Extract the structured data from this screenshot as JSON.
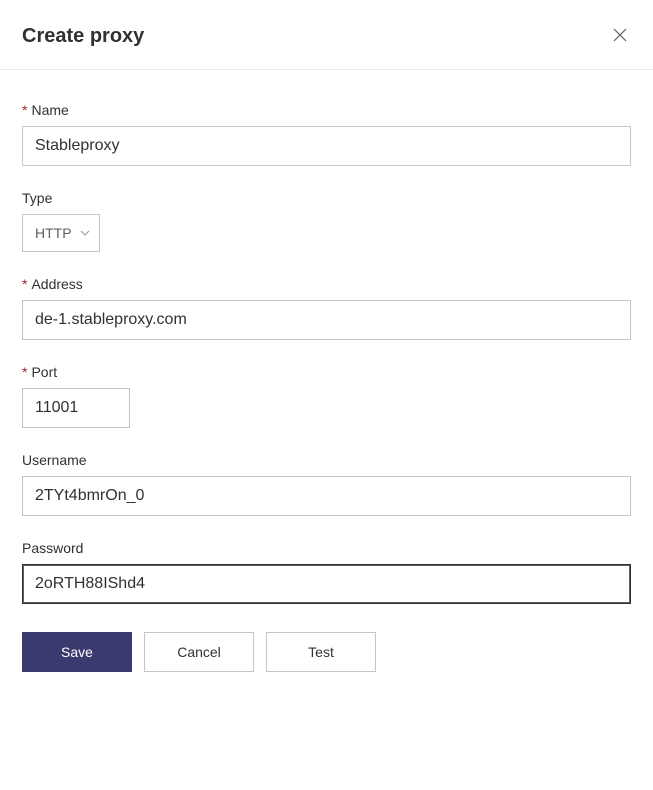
{
  "header": {
    "title": "Create proxy"
  },
  "form": {
    "name": {
      "label": "Name",
      "value": "Stableproxy",
      "required": true
    },
    "type": {
      "label": "Type",
      "value": "HTTP",
      "required": false
    },
    "address": {
      "label": "Address",
      "value": "de-1.stableproxy.com",
      "required": true
    },
    "port": {
      "label": "Port",
      "value": "11001",
      "required": true
    },
    "username": {
      "label": "Username",
      "value": "2TYt4bmrOn_0",
      "required": false
    },
    "password": {
      "label": "Password",
      "value": "2oRTH88IShd4",
      "required": false
    }
  },
  "buttons": {
    "save": "Save",
    "cancel": "Cancel",
    "test": "Test"
  }
}
